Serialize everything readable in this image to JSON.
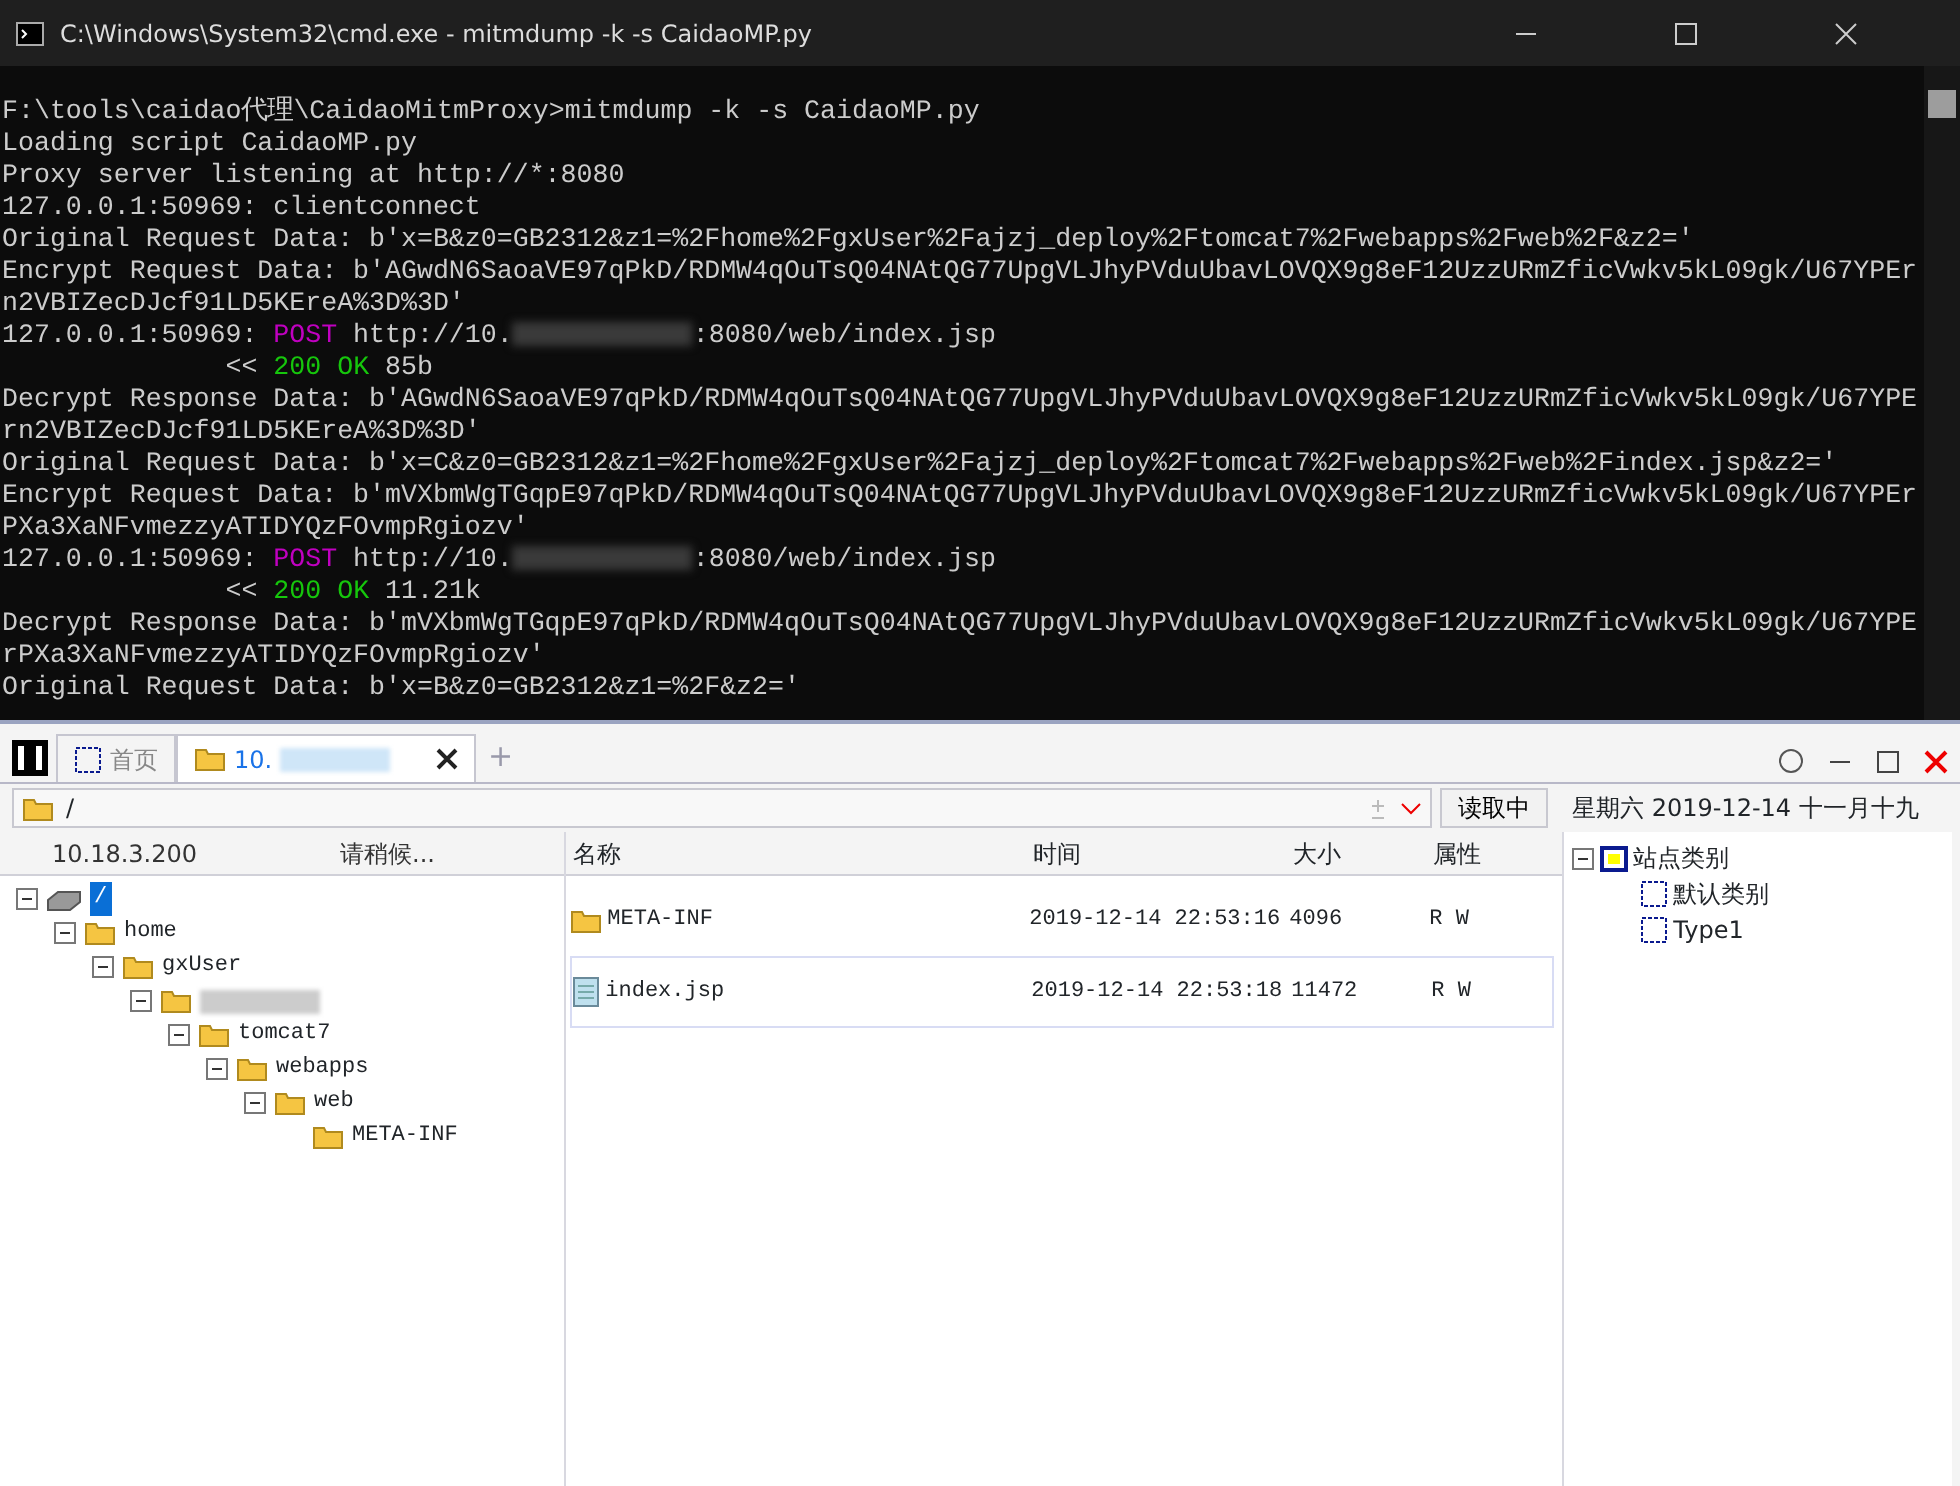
{
  "console_window": {
    "title": "C:\\Windows\\System32\\cmd.exe - mitmdump  -k -s CaidaoMP.py",
    "lines": [
      [
        {
          "kind": "plain",
          "text": "F:\\tools\\caidao代理\\CaidaoMitmProxy>mitmdump -k -s CaidaoMP.py"
        }
      ],
      [
        {
          "kind": "plain",
          "text": "Loading script CaidaoMP.py"
        }
      ],
      [
        {
          "kind": "plain",
          "text": "Proxy server listening at http://*:8080"
        }
      ],
      [
        {
          "kind": "plain",
          "text": "127.0.0.1:50969: clientconnect"
        }
      ],
      [
        {
          "kind": "plain",
          "text": "Original Request Data: b'x=B&z0=GB2312&z1=%2Fhome%2FgxUser%2Fajzj_deploy%2Ftomcat7%2Fwebapps%2Fweb%2F&z2='"
        }
      ],
      [
        {
          "kind": "plain",
          "text": "Encrypt Request Data: b'AGwdN6SaoaVE97qPkD/RDMW4qOuTsQ04NAtQG77UpgVLJhyPVduUbavLOVQX9g8eF12UzzURmZficVwkv5kL09gk/U67YPErn2VBIZecDJcf91LD5KEreA%3D%3D'"
        }
      ],
      [
        {
          "kind": "plain",
          "text": "127.0.0.1:50969: "
        },
        {
          "kind": "method",
          "text": "POST"
        },
        {
          "kind": "plain",
          "text": " http://10."
        },
        {
          "kind": "redacted"
        },
        {
          "kind": "plain",
          "text": ":8080/web/index.jsp"
        }
      ],
      [
        {
          "kind": "plain",
          "text": "              << "
        },
        {
          "kind": "status",
          "text": "200 OK"
        },
        {
          "kind": "plain",
          "text": " 85b"
        }
      ],
      [
        {
          "kind": "plain",
          "text": "Decrypt Response Data: b'AGwdN6SaoaVE97qPkD/RDMW4qOuTsQ04NAtQG77UpgVLJhyPVduUbavLOVQX9g8eF12UzzURmZficVwkv5kL09gk/U67YPErn2VBIZecDJcf91LD5KEreA%3D%3D'"
        }
      ],
      [
        {
          "kind": "plain",
          "text": "Original Request Data: b'x=C&z0=GB2312&z1=%2Fhome%2FgxUser%2Fajzj_deploy%2Ftomcat7%2Fwebapps%2Fweb%2Findex.jsp&z2='"
        }
      ],
      [
        {
          "kind": "plain",
          "text": "Encrypt Request Data: b'mVXbmWgTGqpE97qPkD/RDMW4qOuTsQ04NAtQG77UpgVLJhyPVduUbavLOVQX9g8eF12UzzURmZficVwkv5kL09gk/U67YPErPXa3XaNFvmezzyATIDYQzFOvmpRgiozv'"
        }
      ],
      [
        {
          "kind": "plain",
          "text": "127.0.0.1:50969: "
        },
        {
          "kind": "method",
          "text": "POST"
        },
        {
          "kind": "plain",
          "text": " http://10."
        },
        {
          "kind": "redacted"
        },
        {
          "kind": "plain",
          "text": ":8080/web/index.jsp"
        }
      ],
      [
        {
          "kind": "plain",
          "text": "              << "
        },
        {
          "kind": "status",
          "text": "200 OK"
        },
        {
          "kind": "plain",
          "text": " 11.21k"
        }
      ],
      [
        {
          "kind": "plain",
          "text": "Decrypt Response Data: b'mVXbmWgTGqpE97qPkD/RDMW4qOuTsQ04NAtQG77UpgVLJhyPVduUbavLOVQX9g8eF12UzzURmZficVwkv5kL09gk/U67YPErPXa3XaNFvmezzyATIDYQzFOvmpRgiozv'"
        }
      ],
      [
        {
          "kind": "plain",
          "text": "Original Request Data: b'x=B&z0=GB2312&z1=%2F&z2='"
        }
      ]
    ]
  },
  "app": {
    "tabs": [
      {
        "label": "首页",
        "selected": false,
        "kind": "home"
      },
      {
        "label": "10.",
        "selected": true,
        "kind": "site"
      }
    ],
    "tab_add": "+",
    "path": "/",
    "read_button": "读取中",
    "date": "星期六 2019-12-14 十一月十九",
    "host": "10.18.3.200",
    "loading": "请稍候...",
    "tree": [
      {
        "label": "/",
        "kind": "drive",
        "selected": true,
        "children": [
          {
            "label": "home",
            "kind": "folder",
            "selected": false,
            "children": [
              {
                "label": "gxUser",
                "kind": "folder",
                "selected": false,
                "children": [
                  {
                    "kind": "folder",
                    "selected": false,
                    "children": [
                      {
                        "label": "tomcat7",
                        "kind": "folder",
                        "selected": false,
                        "children": [
                          {
                            "label": "webapps",
                            "kind": "folder",
                            "selected": false,
                            "children": [
                              {
                                "label": "web",
                                "kind": "folder",
                                "selected": false,
                                "children": [
                                  {
                                    "label": "META-INF",
                                    "kind": "folder",
                                    "selected": false
                                  }
                                ]
                              }
                            ]
                          }
                        ]
                      }
                    ]
                  }
                ]
              }
            ]
          }
        ]
      }
    ],
    "columns": [
      "名称",
      "时间",
      "大小",
      "属性"
    ],
    "files": [
      {
        "kind": "folder",
        "name": "META-INF",
        "time": "2019-12-14 22:53:16",
        "size": "4096",
        "attr": "R W",
        "selected": false
      },
      {
        "kind": "file",
        "name": "index.jsp",
        "time": "2019-12-14 22:53:18",
        "size": "11472",
        "attr": "R W",
        "selected": true
      }
    ],
    "categories": {
      "label": "站点类别",
      "children": [
        "默认类别",
        "Type1"
      ]
    }
  }
}
